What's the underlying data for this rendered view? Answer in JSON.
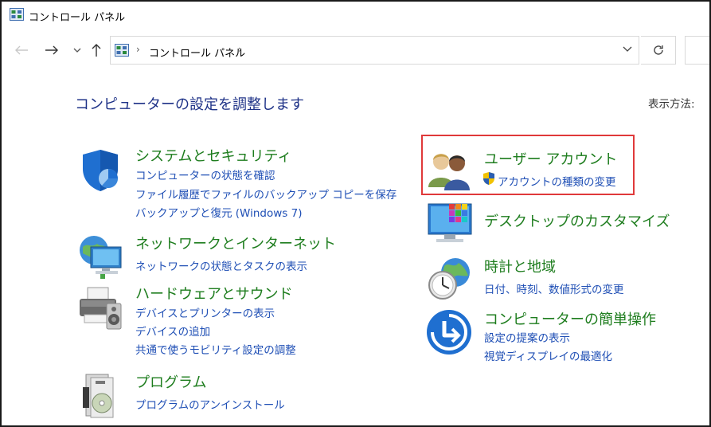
{
  "window": {
    "title": "コントロール パネル"
  },
  "nav": {
    "back_icon": "back-arrow-icon",
    "forward_icon": "forward-arrow-icon",
    "recent_icon": "chevron-down-icon",
    "up_icon": "up-arrow-icon",
    "address": "コントロール パネル",
    "refresh_icon": "refresh-icon"
  },
  "main": {
    "heading": "コンピューターの設定を調整します",
    "view_by": "表示方法:",
    "left_categories": [
      {
        "title": "システムとセキュリティ",
        "icon": "shield-icon",
        "links": [
          "コンピューターの状態を確認",
          "ファイル履歴でファイルのバックアップ コピーを保存",
          "バックアップと復元 (Windows 7)"
        ]
      },
      {
        "title": "ネットワークとインターネット",
        "icon": "network-icon",
        "links": [
          "ネットワークの状態とタスクの表示"
        ]
      },
      {
        "title": "ハードウェアとサウンド",
        "icon": "printer-icon",
        "links": [
          "デバイスとプリンターの表示",
          "デバイスの追加",
          "共通で使うモビリティ設定の調整"
        ]
      },
      {
        "title": "プログラム",
        "icon": "programs-icon",
        "links": [
          "プログラムのアンインストール"
        ]
      }
    ],
    "right_categories": [
      {
        "title": "ユーザー アカウント",
        "icon": "users-icon",
        "links": [
          "アカウントの種類の変更"
        ]
      },
      {
        "title": "デスクトップのカスタマイズ",
        "icon": "desktop-icon",
        "links": []
      },
      {
        "title": "時計と地域",
        "icon": "clock-globe-icon",
        "links": [
          "日付、時刻、数値形式の変更"
        ]
      },
      {
        "title": "コンピューターの簡単操作",
        "icon": "ease-of-access-icon",
        "links": [
          "設定の提案の表示",
          "視覚ディスプレイの最適化"
        ]
      }
    ]
  },
  "colors": {
    "category_title": "#1e7d1e",
    "link": "#1f4fb5",
    "heading": "#1e3287",
    "highlight": "#e0393a"
  }
}
